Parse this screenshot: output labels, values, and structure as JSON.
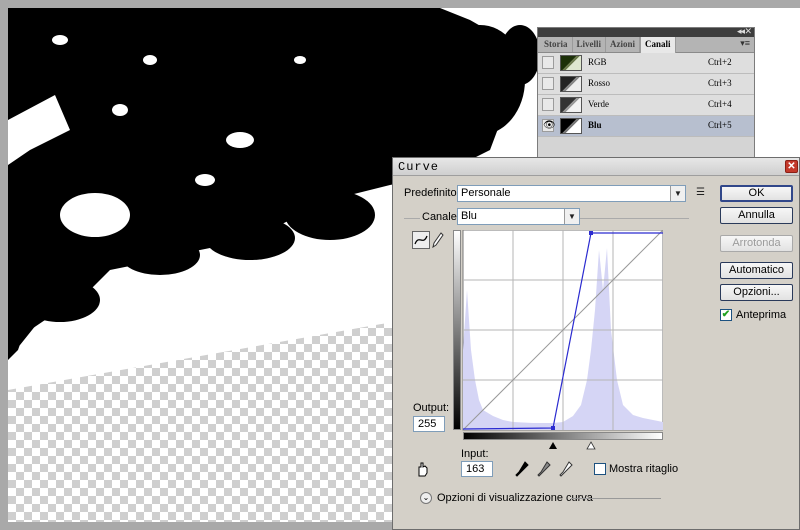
{
  "channels_panel": {
    "tabs": [
      "Storia",
      "Livelli",
      "Azioni",
      "Canali"
    ],
    "active_tab": "Canali",
    "menu_icon": "panel-menu-icon",
    "channels": [
      {
        "name": "RGB",
        "shortcut": "Ctrl+2",
        "visible": false
      },
      {
        "name": "Rosso",
        "shortcut": "Ctrl+3",
        "visible": false
      },
      {
        "name": "Verde",
        "shortcut": "Ctrl+4",
        "visible": false
      },
      {
        "name": "Blu",
        "shortcut": "Ctrl+5",
        "visible": true,
        "selected": true
      }
    ]
  },
  "curves": {
    "title": "Curve",
    "preset_label": "Predefinito:",
    "preset_value": "Personale",
    "channel_label": "Canale:",
    "channel_value": "Blu",
    "buttons": {
      "ok": "OK",
      "cancel": "Annulla",
      "smooth": "Arrotonda",
      "auto": "Automatico",
      "options": "Opzioni..."
    },
    "preview_label": "Anteprima",
    "preview_checked": true,
    "output_label": "Output:",
    "output_value": "255",
    "input_label": "Input:",
    "input_value": "163",
    "show_clipping_label": "Mostra ritaglio",
    "show_clipping_checked": false,
    "display_options_label": "Opzioni di visualizzazione curva",
    "colors": {
      "curve": "#2b2bd0",
      "histogram": "#d5d5f5",
      "dialog_bg": "#d4d0c8"
    }
  }
}
